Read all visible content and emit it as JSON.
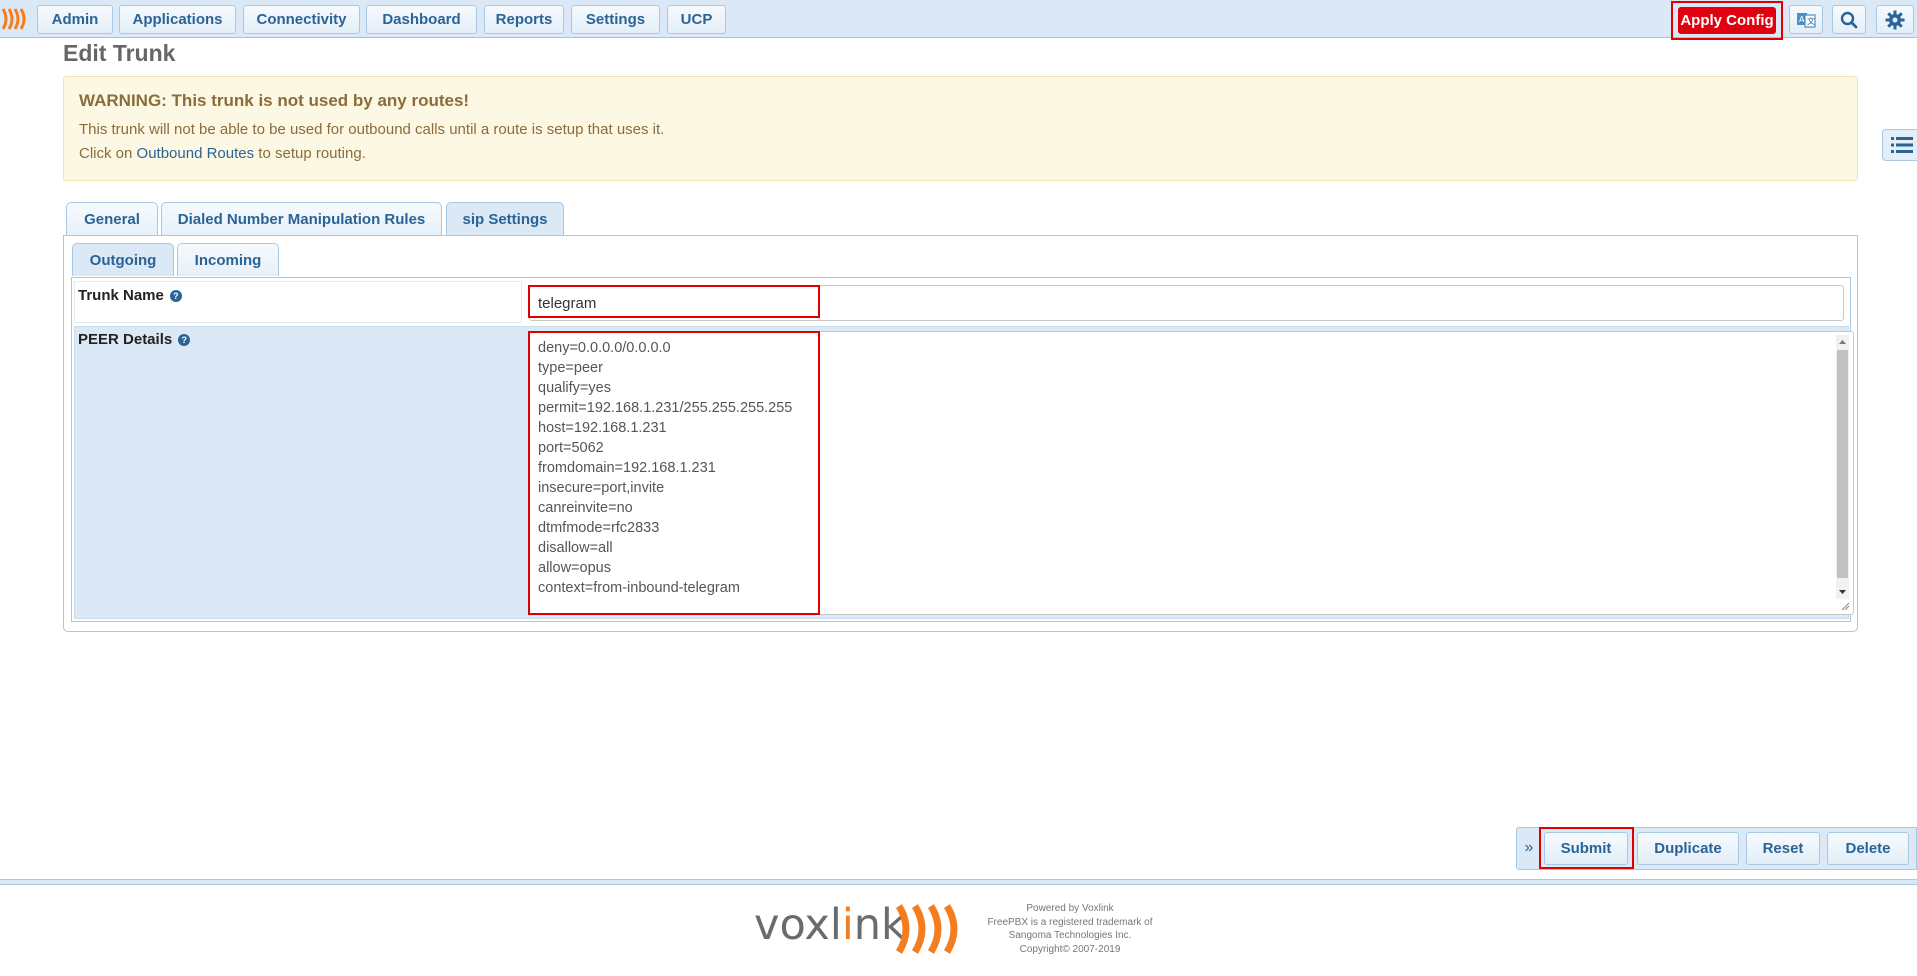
{
  "colors": {
    "accent": "#2a6496",
    "nav_bg": "#dbe9f6",
    "apply_red": "#e0000f",
    "highlight_box": "#e00000",
    "brand_orange": "#f47d20"
  },
  "navbar": {
    "items": [
      "Admin",
      "Applications",
      "Connectivity",
      "Dashboard",
      "Reports",
      "Settings",
      "UCP"
    ],
    "apply_config": "Apply Config",
    "icons": [
      "language-icon",
      "search-icon",
      "gear-icon"
    ]
  },
  "page": {
    "title": "Edit Trunk"
  },
  "warning": {
    "title": "WARNING: This trunk is not used by any routes!",
    "line1": "This trunk will not be able to be used for outbound calls until a route is setup that uses it.",
    "line2_prefix": "Click on",
    "line2_link": "Outbound Routes",
    "line2_suffix": "to setup routing."
  },
  "tabs": [
    "General",
    "Dialed Number Manipulation Rules",
    "sip Settings"
  ],
  "active_tab": "sip Settings",
  "subtabs": [
    "Outgoing",
    "Incoming"
  ],
  "active_subtab": "Outgoing",
  "form": {
    "trunk_name_label": "Trunk Name",
    "trunk_name_value": "telegram",
    "peer_details_label": "PEER Details",
    "peer_details_lines": [
      "deny=0.0.0.0/0.0.0.0",
      "type=peer",
      "qualify=yes",
      "permit=192.168.1.231/255.255.255.255",
      "host=192.168.1.231",
      "port=5062",
      "fromdomain=192.168.1.231",
      "insecure=port,invite",
      "canreinvite=no",
      "dtmfmode=rfc2833",
      "disallow=all",
      "allow=opus",
      "context=from-inbound-telegram"
    ],
    "help_glyph": "?"
  },
  "actions": {
    "collapse": "»",
    "submit": "Submit",
    "duplicate": "Duplicate",
    "reset": "Reset",
    "delete": "Delete"
  },
  "footer": {
    "logo_main": "voxl",
    "logo_accent": "i",
    "logo_end": "nk",
    "info": [
      "Powered by Voxlink",
      "FreePBX is a registered trademark of",
      "Sangoma Technologies Inc.",
      "Copyright© 2007-2019"
    ]
  }
}
